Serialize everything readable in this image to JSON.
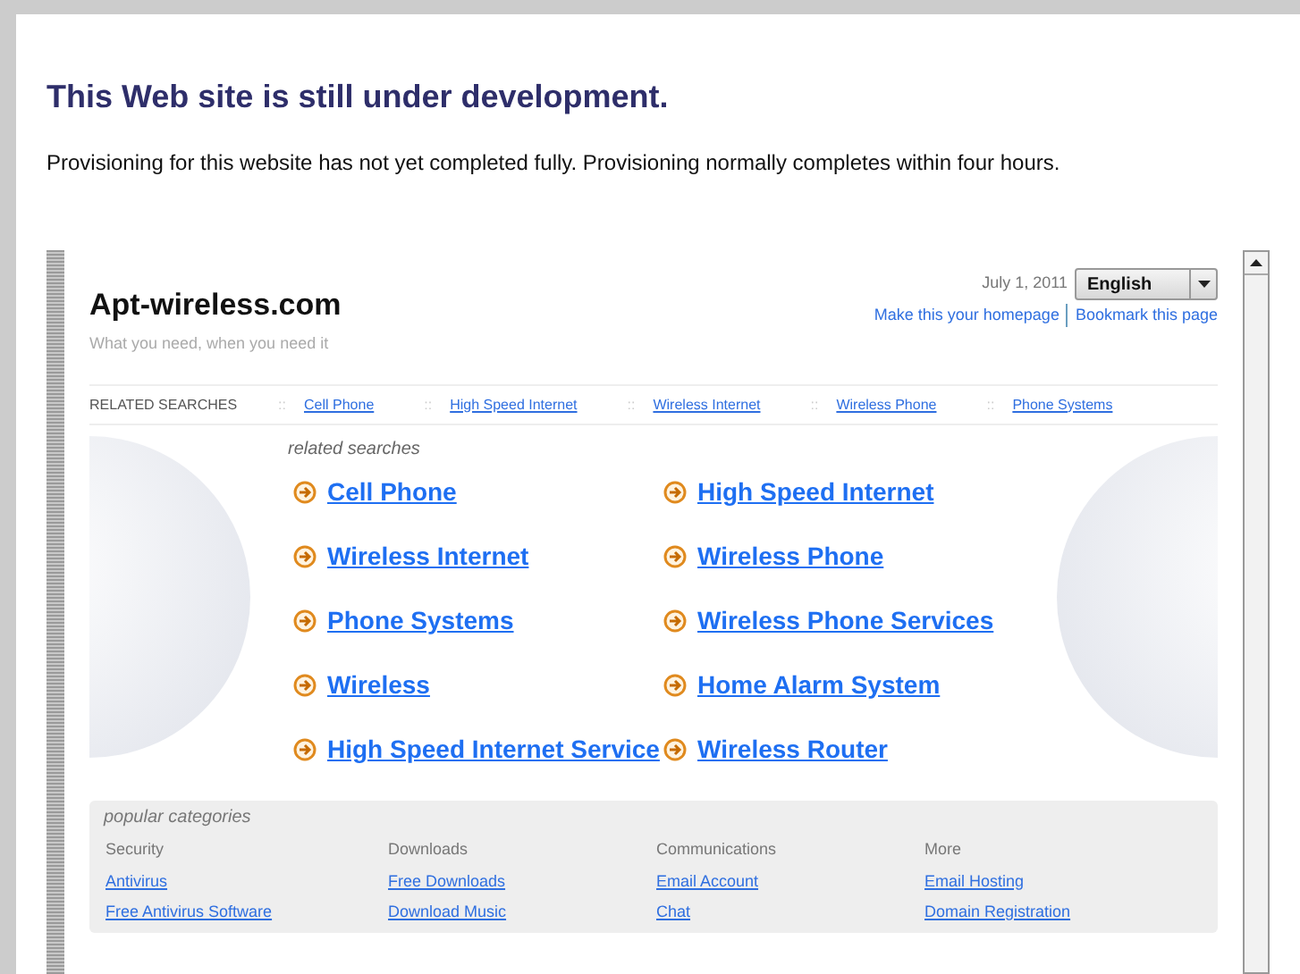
{
  "heading": "This Web site is still under development.",
  "message": "Provisioning for this website has not yet completed fully. Provisioning normally completes within four hours.",
  "frame": {
    "site_title": "Apt-wireless.com",
    "tagline": "What you need, when you need it",
    "date": "July 1, 2011",
    "language": {
      "value": "English"
    },
    "top_links": [
      "Make this your homepage",
      "Bookmark this page"
    ],
    "related_bar": {
      "label": "RELATED SEARCHES",
      "separator": "::",
      "links": [
        "Cell Phone",
        "High Speed Internet",
        "Wireless Internet",
        "Wireless Phone",
        "Phone Systems"
      ]
    },
    "related_heading": "related searches",
    "related_links": [
      "Cell Phone",
      "High Speed Internet",
      "Wireless Internet",
      "Wireless Phone",
      "Phone Systems",
      "Wireless Phone Services",
      "Wireless",
      "Home Alarm System",
      "High Speed Internet Service",
      "Wireless Router"
    ],
    "popular": {
      "heading": "popular categories",
      "columns": [
        {
          "title": "Security",
          "links": [
            "Antivirus",
            "Free Antivirus Software"
          ]
        },
        {
          "title": "Downloads",
          "links": [
            "Free Downloads",
            "Download Music"
          ]
        },
        {
          "title": "Communications",
          "links": [
            "Email Account",
            "Chat"
          ]
        },
        {
          "title": "More",
          "links": [
            "Email Hosting",
            "Domain Registration"
          ]
        }
      ]
    }
  }
}
